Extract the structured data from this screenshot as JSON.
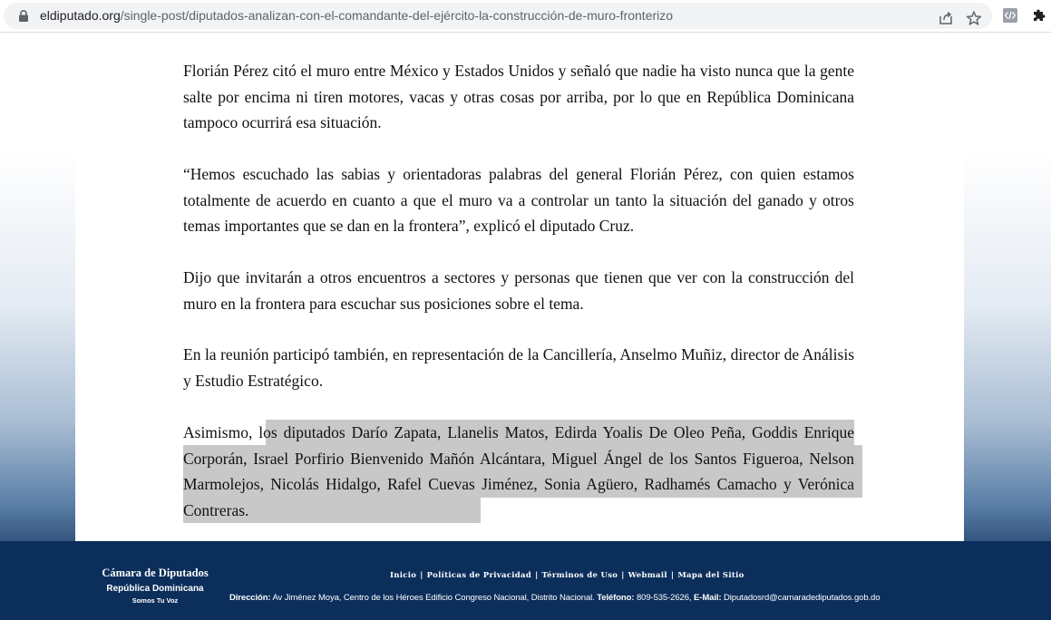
{
  "browser": {
    "url_host": "eldiputado.org",
    "url_path": "/single-post/diputados-analizan-con-el-comandante-del-ejército-la-construcción-de-muro-fronterizo",
    "icons": [
      "lock-icon",
      "share-icon",
      "star-icon",
      "extension-code-icon",
      "puzzle-icon"
    ]
  },
  "article": {
    "paragraphs": [
      "Florián Pérez citó el muro entre México y Estados Unidos y señaló que nadie ha visto nunca que la gente salte por encima ni tiren motores, vacas y otras cosas por arriba, por lo que en República Dominicana tampoco ocurrirá esa situación.",
      "“Hemos escuchado las sabias y orientadoras palabras del general Florián Pérez, con quien estamos totalmente de acuerdo en cuanto a que el muro va a controlar un tanto la situación del ganado y otros temas importantes que se dan en la frontera”, explicó el diputado Cruz.",
      "Dijo que invitarán a otros encuentros a sectores y personas que tienen que ver con la construcción del muro en la frontera para escuchar sus posiciones sobre el tema.",
      "En la reunión participó también, en representación de la Cancillería, Anselmo Muñiz, director de Análisis y Estudio Estratégico."
    ],
    "last_paragraph_start": "Asimismo,",
    "last_paragraph_highlighted": "los diputados Darío Zapata, Llanelis Matos, Edirda Yoalis De Oleo Peña, Goddis Enrique Corporán, Israel Porfirio Bienvenido Mañón Alcántara, Miguel Ángel de los Santos Figueroa, Nelson Marmolejos, Nicolás Hidalgo, Rafel Cuevas Jiménez, Sonia Agüero, Radhamés Camacho y Verónica Contreras."
  },
  "footer": {
    "org_name": "Cámara de Diputados",
    "country": "República Dominicana",
    "slogan": "Somos Tu Voz",
    "links": [
      "Inicio",
      "Políticas de Privacidad",
      "Términos de Uso",
      "Webmail",
      "Mapa del Sitio"
    ],
    "separator": "|",
    "address_label": "Dirección:",
    "address_value": "Av Jiménez Moya, Centro de los Héroes  Edificio Congreso Nacional, Distrito Nacional.",
    "phone_label": "Teléfono:",
    "phone_value": "809-535-2626,",
    "email_label": "E-Mail:",
    "email_value": "Diputadosrd@camaradediputados.gob.do"
  },
  "colors": {
    "footer_bg": "#0b2e5b",
    "highlight": "#c8c8c8",
    "omnibox_bg": "#f1f3f4"
  }
}
